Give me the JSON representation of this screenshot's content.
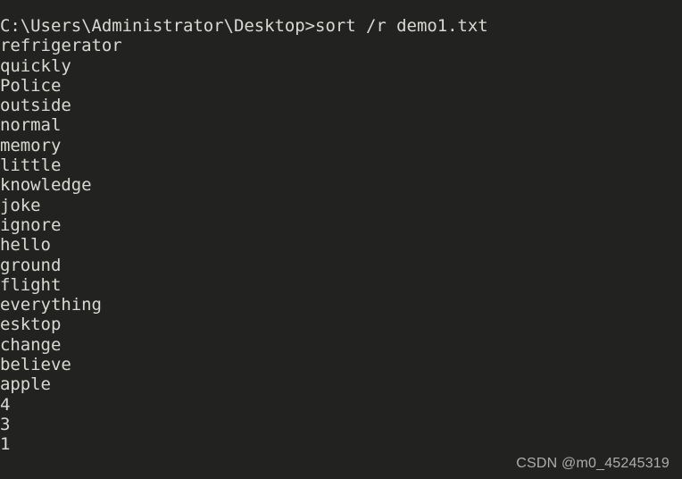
{
  "terminal": {
    "app": "Windows Command Prompt",
    "background_color": "#222220",
    "text_color": "#d8d8d4",
    "prompt_path": "C:\\Users\\Administrator\\Desktop",
    "prompt_symbol": ">",
    "command": "sort /r demo1.txt",
    "command_line": "C:\\Users\\Administrator\\Desktop>sort /r demo1.txt",
    "output_lines": [
      "refrigerator",
      "quickly",
      "Police",
      "outside",
      "normal",
      "memory",
      "little",
      "knowledge",
      "joke",
      "ignore",
      "hello",
      "ground",
      "flight",
      "everything",
      "esktop",
      "change",
      "believe",
      "apple",
      "4",
      "3",
      "1"
    ]
  },
  "watermark": {
    "text": "CSDN @m0_45245319",
    "color": "#b9b9b7"
  }
}
